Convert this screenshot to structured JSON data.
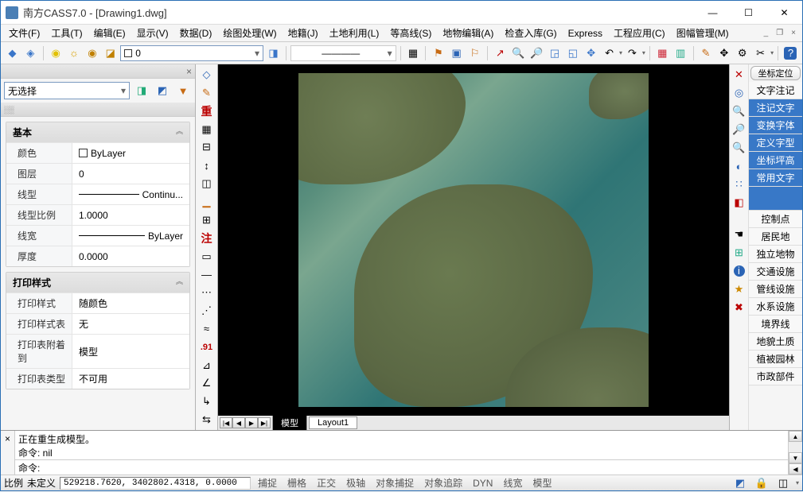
{
  "title": "南方CASS7.0 - [Drawing1.dwg]",
  "window_controls": {
    "min": "—",
    "max": "☐",
    "close": "✕"
  },
  "mdi_controls": {
    "min": "_",
    "restore": "❐",
    "close": "×"
  },
  "menu": [
    "文件(F)",
    "工具(T)",
    "编辑(E)",
    "显示(V)",
    "数据(D)",
    "绘图处理(W)",
    "地籍(J)",
    "土地利用(L)",
    "等高线(S)",
    "地物编辑(A)",
    "检查入库(G)",
    "Express",
    "工程应用(C)",
    "图幅管理(M)"
  ],
  "toolbar1": {
    "layer_value": "0",
    "dropdown_icon": "▾",
    "linewidth_label": "————"
  },
  "left": {
    "panel_x": "×",
    "selector": "无选择",
    "sections": {
      "basic": {
        "title": "基本",
        "rows": [
          {
            "k": "颜色",
            "v": "ByLayer",
            "swatch": true
          },
          {
            "k": "图层",
            "v": "0"
          },
          {
            "k": "线型",
            "v": "Continu...",
            "line": true
          },
          {
            "k": "线型比例",
            "v": "1.0000"
          },
          {
            "k": "线宽",
            "v": "ByLayer",
            "line": true
          },
          {
            "k": "厚度",
            "v": "0.0000"
          }
        ]
      },
      "print": {
        "title": "打印样式",
        "rows": [
          {
            "k": "打印样式",
            "v": "随颜色"
          },
          {
            "k": "打印样式表",
            "v": "无"
          },
          {
            "k": "打印表附着到",
            "v": "模型"
          },
          {
            "k": "打印表类型",
            "v": "不可用"
          }
        ]
      }
    }
  },
  "vtoolbar_labels": {
    "chong": "重",
    "zhu": "注",
    "num": ".91"
  },
  "canvas_tabs": {
    "nav": [
      "|◀",
      "◀",
      "▶",
      "▶|"
    ],
    "tabs": [
      "模型",
      "Layout1"
    ]
  },
  "right": {
    "category_tab": "坐标定位",
    "text_header": "文字注记",
    "active_group": [
      "注记文字",
      "变换字体",
      "定义字型",
      "坐标坪高",
      "常用文字"
    ],
    "nav_items": [
      "控制点",
      "居民地",
      "独立地物",
      "交通设施",
      "管线设施",
      "水系设施",
      "境界线",
      "地貌土质",
      "植被园林",
      "市政部件"
    ]
  },
  "cmd": {
    "history": "正在重生成模型。\n命令: nil",
    "prompt": "命令:"
  },
  "status": {
    "scale_label": "比例",
    "scale_value": "未定义",
    "coords": "529218.7620, 3402802.4318, 0.0000",
    "buttons": [
      "捕捉",
      "栅格",
      "正交",
      "极轴",
      "对象捕捉",
      "对象追踪",
      "DYN",
      "线宽",
      "模型"
    ]
  }
}
